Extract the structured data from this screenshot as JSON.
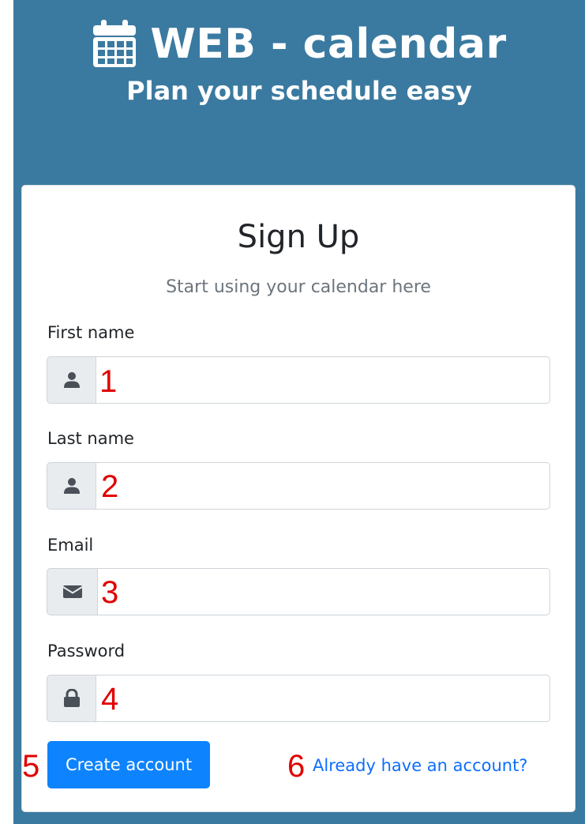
{
  "header": {
    "brand_title": "WEB - calendar",
    "tagline": "Plan your schedule easy",
    "brand_icon": "calendar-icon"
  },
  "form": {
    "title": "Sign Up",
    "subtitle": "Start using your calendar here",
    "fields": [
      {
        "label": "First name",
        "icon": "user-icon",
        "value": "",
        "marker": "1"
      },
      {
        "label": "Last name",
        "icon": "user-icon",
        "value": "",
        "marker": "2"
      },
      {
        "label": "Email",
        "icon": "envelope-icon",
        "value": "",
        "marker": "3"
      },
      {
        "label": "Password",
        "icon": "lock-icon",
        "value": "",
        "marker": "4"
      }
    ],
    "submit_label": "Create account",
    "submit_marker": "5",
    "login_link_label": "Already have an account?",
    "login_link_marker": "6"
  },
  "colors": {
    "header_background": "#3b7aa0",
    "primary_button": "#0d83fd",
    "link": "#0d6efd",
    "annotation_marker": "#e00000",
    "input_addon": "#e9ecef"
  }
}
